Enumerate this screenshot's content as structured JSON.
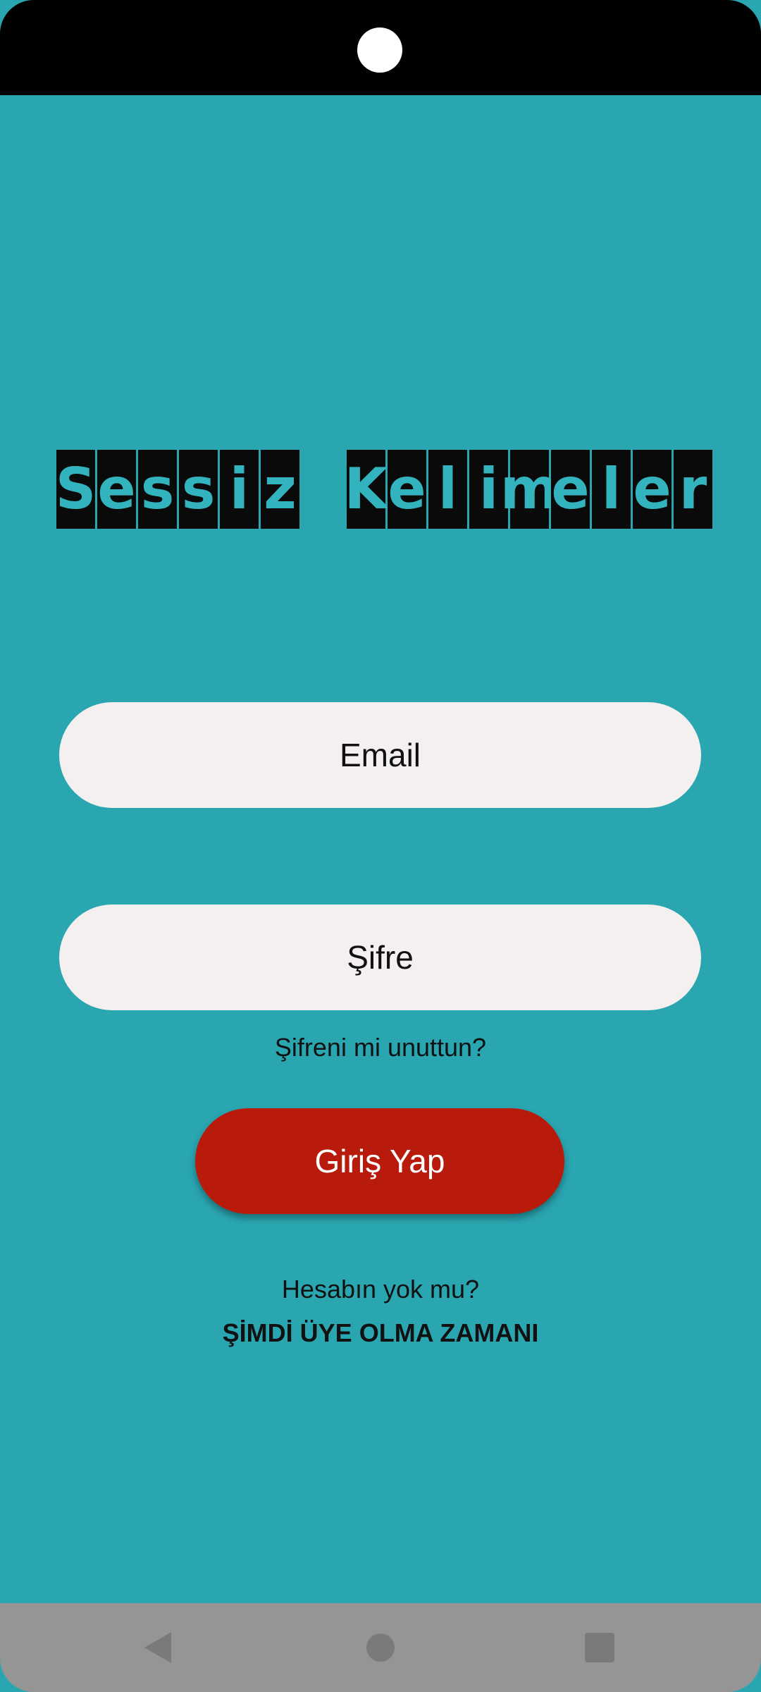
{
  "app": {
    "title_word1": [
      "S",
      "e",
      "s",
      "s",
      "i",
      "z"
    ],
    "title_word2": [
      "K",
      "e",
      "l",
      "i",
      "m",
      "e",
      "l",
      "e",
      "r"
    ]
  },
  "form": {
    "email_placeholder": "Email",
    "password_placeholder": "Şifre",
    "forgot_password": "Şifreni mi unuttun?",
    "login_button": "Giriş Yap",
    "no_account": "Hesabın yok mu?",
    "signup_link": "ŞİMDİ ÜYE OLMA ZAMANI"
  },
  "colors": {
    "background": "#2aa6b1",
    "input_bg": "#f4f0ef",
    "login_button_bg": "#b81b0c",
    "nav_bar": "#959595"
  },
  "icons": {
    "camera": "camera-cutout-icon",
    "back": "back-triangle-icon",
    "home": "home-circle-icon",
    "recent": "recent-apps-square-icon"
  }
}
